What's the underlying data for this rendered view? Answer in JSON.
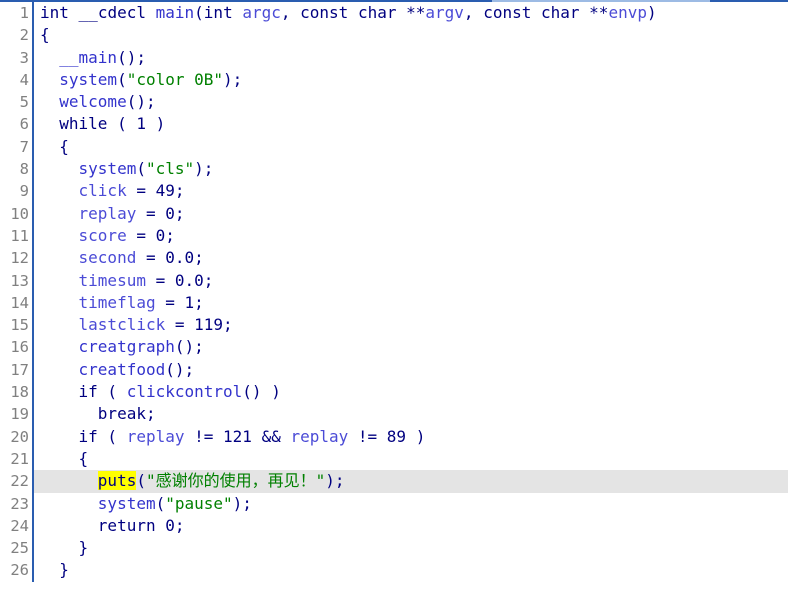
{
  "view": {
    "name": "pseudocode-view",
    "current_line": 22,
    "colors": {
      "keyword": "#000080",
      "function": "#3333cc",
      "identifier": "#4b4bd6",
      "string": "#008000",
      "line_number": "#808080",
      "gutter_divider": "#2a5db0",
      "current_line_background": "#e4e4e4",
      "token_highlight": "#ffff00",
      "background": "#ffffff"
    }
  },
  "lines": [
    {
      "number": "1",
      "tokens": [
        {
          "t": "int",
          "c": "kw"
        },
        {
          "t": " ",
          "c": "plain"
        },
        {
          "t": "__cdecl",
          "c": "kw"
        },
        {
          "t": " ",
          "c": "plain"
        },
        {
          "t": "main",
          "c": "fn"
        },
        {
          "t": "(",
          "c": "punct"
        },
        {
          "t": "int",
          "c": "kw"
        },
        {
          "t": " ",
          "c": "plain"
        },
        {
          "t": "argc",
          "c": "id"
        },
        {
          "t": ", ",
          "c": "punct"
        },
        {
          "t": "const",
          "c": "kw"
        },
        {
          "t": " ",
          "c": "plain"
        },
        {
          "t": "char",
          "c": "kw"
        },
        {
          "t": " **",
          "c": "punct"
        },
        {
          "t": "argv",
          "c": "id"
        },
        {
          "t": ", ",
          "c": "punct"
        },
        {
          "t": "const",
          "c": "kw"
        },
        {
          "t": " ",
          "c": "plain"
        },
        {
          "t": "char",
          "c": "kw"
        },
        {
          "t": " **",
          "c": "punct"
        },
        {
          "t": "envp",
          "c": "id"
        },
        {
          "t": ")",
          "c": "punct"
        }
      ]
    },
    {
      "number": "2",
      "tokens": [
        {
          "t": "{",
          "c": "punct"
        }
      ]
    },
    {
      "number": "3",
      "tokens": [
        {
          "t": "  ",
          "c": "plain"
        },
        {
          "t": "__main",
          "c": "fn"
        },
        {
          "t": "();",
          "c": "punct"
        }
      ]
    },
    {
      "number": "4",
      "tokens": [
        {
          "t": "  ",
          "c": "plain"
        },
        {
          "t": "system",
          "c": "fn"
        },
        {
          "t": "(",
          "c": "punct"
        },
        {
          "t": "\"color 0B\"",
          "c": "str"
        },
        {
          "t": ");",
          "c": "punct"
        }
      ]
    },
    {
      "number": "5",
      "tokens": [
        {
          "t": "  ",
          "c": "plain"
        },
        {
          "t": "welcome",
          "c": "fn"
        },
        {
          "t": "();",
          "c": "punct"
        }
      ]
    },
    {
      "number": "6",
      "tokens": [
        {
          "t": "  ",
          "c": "plain"
        },
        {
          "t": "while",
          "c": "kw"
        },
        {
          "t": " ( ",
          "c": "punct"
        },
        {
          "t": "1",
          "c": "num"
        },
        {
          "t": " )",
          "c": "punct"
        }
      ]
    },
    {
      "number": "7",
      "tokens": [
        {
          "t": "  {",
          "c": "punct"
        }
      ]
    },
    {
      "number": "8",
      "tokens": [
        {
          "t": "    ",
          "c": "plain"
        },
        {
          "t": "system",
          "c": "fn"
        },
        {
          "t": "(",
          "c": "punct"
        },
        {
          "t": "\"cls\"",
          "c": "str"
        },
        {
          "t": ");",
          "c": "punct"
        }
      ]
    },
    {
      "number": "9",
      "tokens": [
        {
          "t": "    ",
          "c": "plain"
        },
        {
          "t": "click",
          "c": "id"
        },
        {
          "t": " = ",
          "c": "punct"
        },
        {
          "t": "49",
          "c": "num"
        },
        {
          "t": ";",
          "c": "punct"
        }
      ]
    },
    {
      "number": "10",
      "tokens": [
        {
          "t": "    ",
          "c": "plain"
        },
        {
          "t": "replay",
          "c": "id"
        },
        {
          "t": " = ",
          "c": "punct"
        },
        {
          "t": "0",
          "c": "num"
        },
        {
          "t": ";",
          "c": "punct"
        }
      ]
    },
    {
      "number": "11",
      "tokens": [
        {
          "t": "    ",
          "c": "plain"
        },
        {
          "t": "score",
          "c": "id"
        },
        {
          "t": " = ",
          "c": "punct"
        },
        {
          "t": "0",
          "c": "num"
        },
        {
          "t": ";",
          "c": "punct"
        }
      ]
    },
    {
      "number": "12",
      "tokens": [
        {
          "t": "    ",
          "c": "plain"
        },
        {
          "t": "second",
          "c": "id"
        },
        {
          "t": " = ",
          "c": "punct"
        },
        {
          "t": "0.0",
          "c": "num"
        },
        {
          "t": ";",
          "c": "punct"
        }
      ]
    },
    {
      "number": "13",
      "tokens": [
        {
          "t": "    ",
          "c": "plain"
        },
        {
          "t": "timesum",
          "c": "id"
        },
        {
          "t": " = ",
          "c": "punct"
        },
        {
          "t": "0.0",
          "c": "num"
        },
        {
          "t": ";",
          "c": "punct"
        }
      ]
    },
    {
      "number": "14",
      "tokens": [
        {
          "t": "    ",
          "c": "plain"
        },
        {
          "t": "timeflag",
          "c": "id"
        },
        {
          "t": " = ",
          "c": "punct"
        },
        {
          "t": "1",
          "c": "num"
        },
        {
          "t": ";",
          "c": "punct"
        }
      ]
    },
    {
      "number": "15",
      "tokens": [
        {
          "t": "    ",
          "c": "plain"
        },
        {
          "t": "lastclick",
          "c": "id"
        },
        {
          "t": " = ",
          "c": "punct"
        },
        {
          "t": "119",
          "c": "num"
        },
        {
          "t": ";",
          "c": "punct"
        }
      ]
    },
    {
      "number": "16",
      "tokens": [
        {
          "t": "    ",
          "c": "plain"
        },
        {
          "t": "creatgraph",
          "c": "fn"
        },
        {
          "t": "();",
          "c": "punct"
        }
      ]
    },
    {
      "number": "17",
      "tokens": [
        {
          "t": "    ",
          "c": "plain"
        },
        {
          "t": "creatfood",
          "c": "fn"
        },
        {
          "t": "();",
          "c": "punct"
        }
      ]
    },
    {
      "number": "18",
      "tokens": [
        {
          "t": "    ",
          "c": "plain"
        },
        {
          "t": "if",
          "c": "kw"
        },
        {
          "t": " ( ",
          "c": "punct"
        },
        {
          "t": "clickcontrol",
          "c": "fn"
        },
        {
          "t": "() )",
          "c": "punct"
        }
      ]
    },
    {
      "number": "19",
      "tokens": [
        {
          "t": "      ",
          "c": "plain"
        },
        {
          "t": "break",
          "c": "kw"
        },
        {
          "t": ";",
          "c": "punct"
        }
      ]
    },
    {
      "number": "20",
      "tokens": [
        {
          "t": "    ",
          "c": "plain"
        },
        {
          "t": "if",
          "c": "kw"
        },
        {
          "t": " ( ",
          "c": "punct"
        },
        {
          "t": "replay",
          "c": "id"
        },
        {
          "t": " != ",
          "c": "punct"
        },
        {
          "t": "121",
          "c": "num"
        },
        {
          "t": " && ",
          "c": "punct"
        },
        {
          "t": "replay",
          "c": "id"
        },
        {
          "t": " != ",
          "c": "punct"
        },
        {
          "t": "89",
          "c": "num"
        },
        {
          "t": " )",
          "c": "punct"
        }
      ]
    },
    {
      "number": "21",
      "tokens": [
        {
          "t": "    {",
          "c": "punct"
        }
      ]
    },
    {
      "number": "22",
      "current": true,
      "tokens": [
        {
          "t": "      ",
          "c": "plain"
        },
        {
          "t": "puts",
          "c": "hl"
        },
        {
          "t": "(",
          "c": "punct"
        },
        {
          "t": "\"感谢你的使用，再见！\"",
          "c": "str"
        },
        {
          "t": ");",
          "c": "punct"
        }
      ]
    },
    {
      "number": "23",
      "tokens": [
        {
          "t": "      ",
          "c": "plain"
        },
        {
          "t": "system",
          "c": "fn"
        },
        {
          "t": "(",
          "c": "punct"
        },
        {
          "t": "\"pause\"",
          "c": "str"
        },
        {
          "t": ");",
          "c": "punct"
        }
      ]
    },
    {
      "number": "24",
      "tokens": [
        {
          "t": "      ",
          "c": "plain"
        },
        {
          "t": "return",
          "c": "kw"
        },
        {
          "t": " ",
          "c": "plain"
        },
        {
          "t": "0",
          "c": "num"
        },
        {
          "t": ";",
          "c": "punct"
        }
      ]
    },
    {
      "number": "25",
      "tokens": [
        {
          "t": "    }",
          "c": "punct"
        }
      ]
    },
    {
      "number": "26",
      "tokens": [
        {
          "t": "  }",
          "c": "punct"
        }
      ]
    }
  ]
}
